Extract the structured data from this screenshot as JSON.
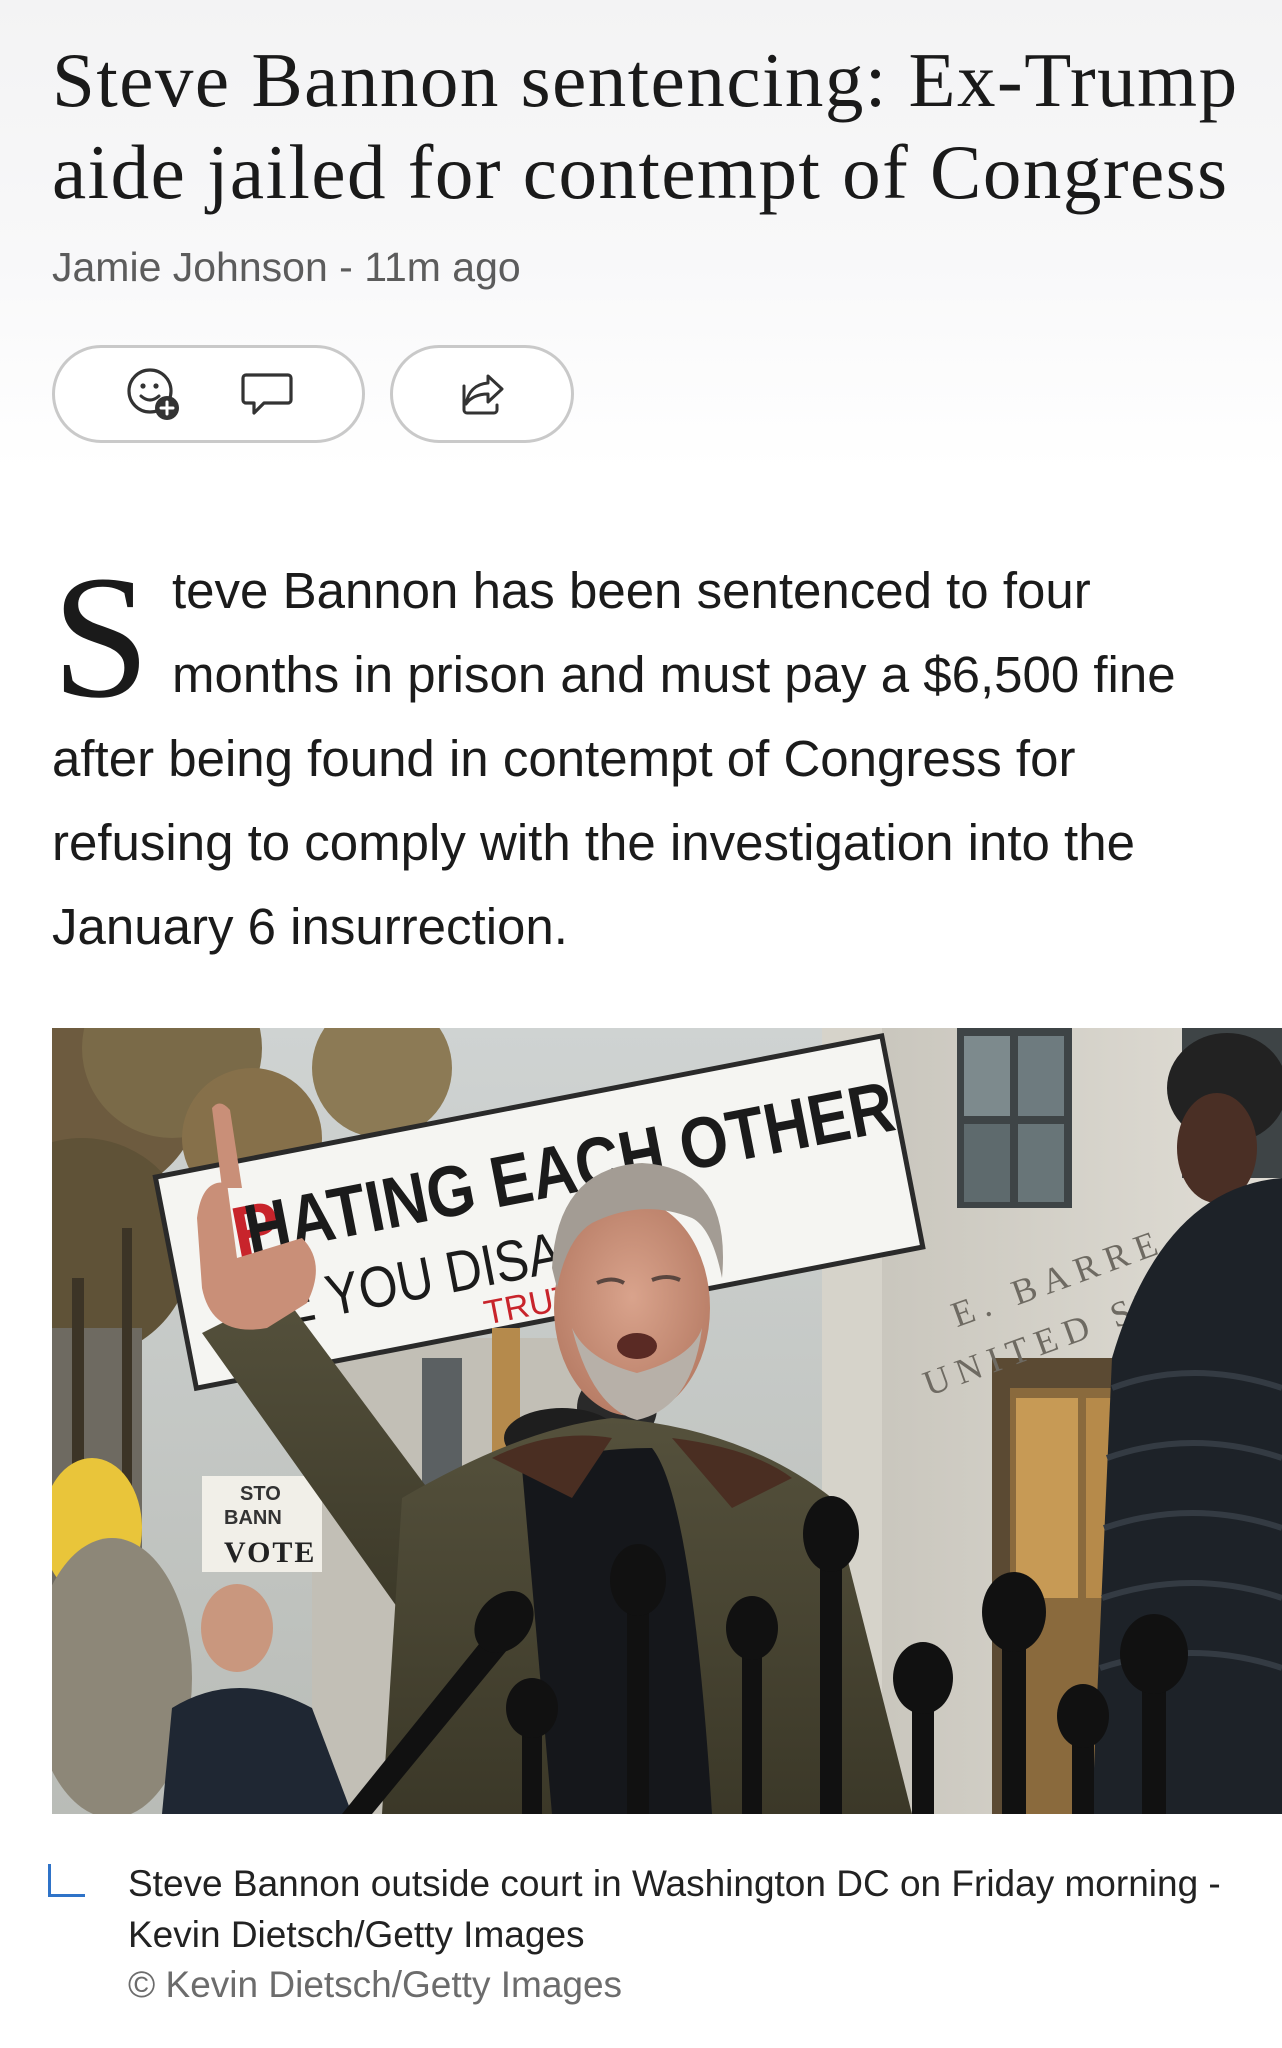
{
  "article": {
    "headline_line1": "Steve Bannon sentencing: Ex-Trump",
    "headline_line2": "aide jailed for contempt of Congress",
    "byline": "Jamie Johnson - 11m ago"
  },
  "actions": {
    "react_icon": "add-reaction-icon",
    "comment_icon": "comment-icon",
    "share_icon": "share-icon"
  },
  "body": {
    "dropcap": "S",
    "line1": "teve Bannon has been sentenced to four",
    "line2": "months in prison and must pay a $6,500 fine",
    "line3": "after being found in contempt of Congress for",
    "line4": "refusing to comply with the investigation into the",
    "line5": "January 6 insurrection."
  },
  "photo": {
    "sign_main": "HATING EACH OTHER",
    "sign_main_prefix": "P",
    "sign_sub": "SE YOU DISAGRE",
    "sign_brand": "TRUTH C",
    "building_inscription_1": "E. BARRE",
    "building_inscription_2": "UNITED ST",
    "small_sign_1": "STO",
    "small_sign_2": "BANN",
    "small_sign_3": "VOTE"
  },
  "caption": {
    "text_line1": "Steve Bannon outside court in Washington DC on Friday morning -",
    "text_line2": "Kevin Dietsch/Getty Images",
    "copyright": "© Kevin Dietsch/Getty Images"
  },
  "colors": {
    "accent_blue": "#2f73c8",
    "sign_red": "#c8242b",
    "text": "#1b1b1b",
    "muted": "#5c5c5c"
  }
}
